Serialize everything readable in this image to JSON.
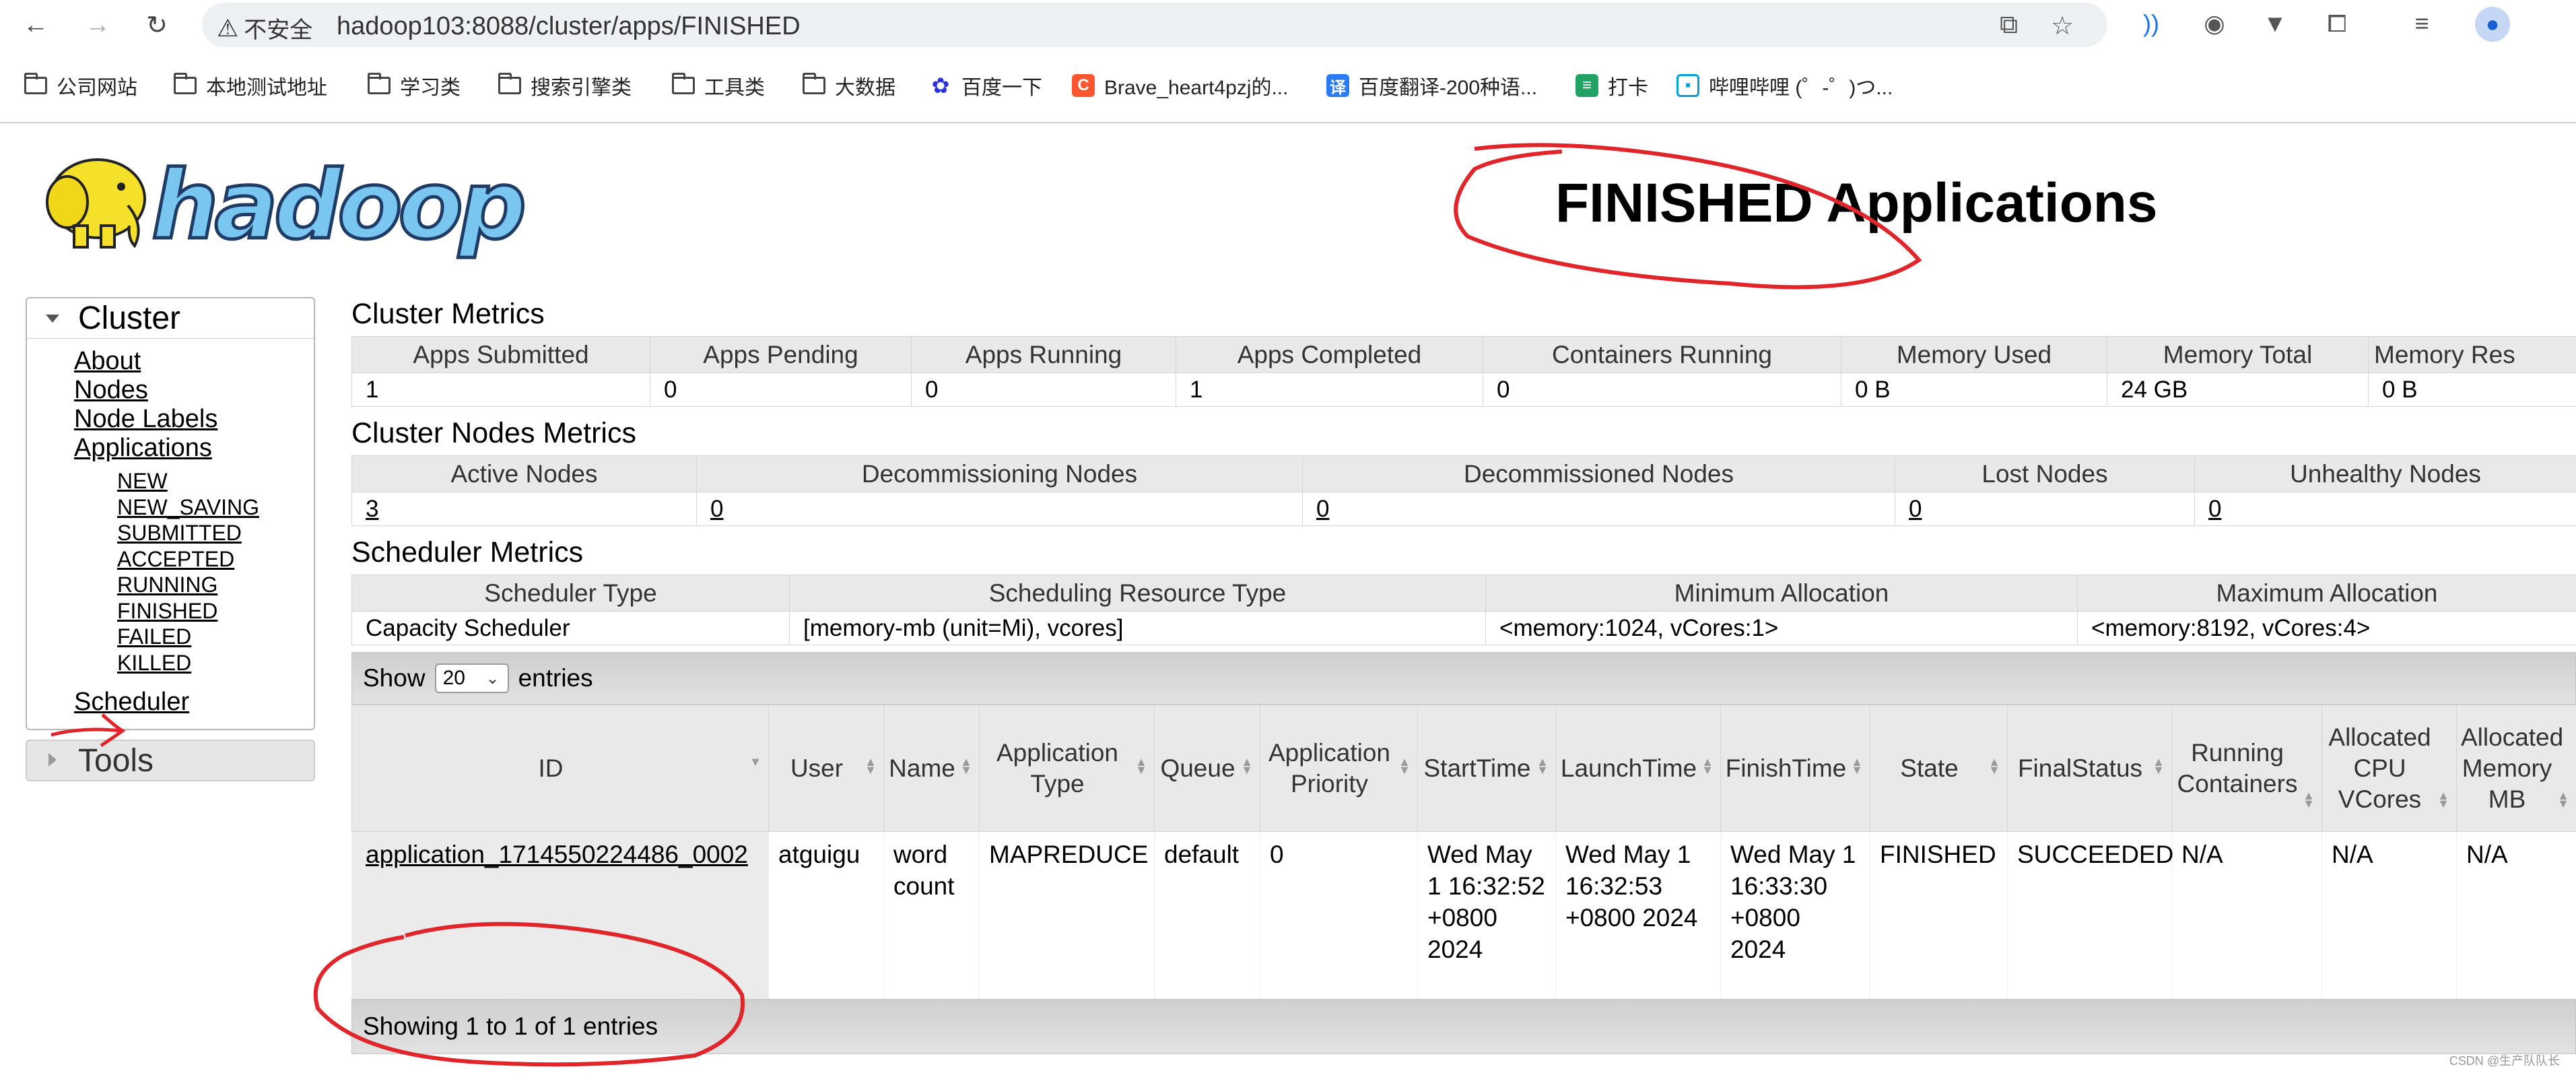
{
  "browser": {
    "security_label": "不安全",
    "url": "hadoop103:8088/cluster/apps/FINISHED",
    "bookmarks": [
      {
        "label": "公司网站",
        "icon": "folder-icon"
      },
      {
        "label": "本地测试地址",
        "icon": "folder-icon"
      },
      {
        "label": "学习类",
        "icon": "folder-icon"
      },
      {
        "label": "搜索引擎类",
        "icon": "folder-icon"
      },
      {
        "label": "工具类",
        "icon": "folder-icon"
      },
      {
        "label": "大数据",
        "icon": "folder-icon"
      },
      {
        "label": "百度一下",
        "icon": "baidu-paw-icon"
      },
      {
        "label": "Brave_heart4pzj的...",
        "icon": "csdn-icon"
      },
      {
        "label": "百度翻译-200种语...",
        "icon": "translate-icon"
      },
      {
        "label": "打卡",
        "icon": "sheet-icon"
      },
      {
        "label": "哔哩哔哩 (゜-゜)つ...",
        "icon": "bilibili-icon"
      }
    ],
    "colors": {
      "baidu": "#2932e1",
      "csdn": "#fc5531",
      "translate": "#2a7bf6",
      "sheet": "#21a366",
      "bilibili": "#00a1d6"
    }
  },
  "header": {
    "logo_text": "hadoop",
    "title": "FINISHED Applications"
  },
  "sidebar": {
    "cluster_label": "Cluster",
    "links": [
      "About",
      "Nodes",
      "Node Labels",
      "Applications"
    ],
    "app_states": [
      "NEW",
      "NEW_SAVING",
      "SUBMITTED",
      "ACCEPTED",
      "RUNNING",
      "FINISHED",
      "FAILED",
      "KILLED"
    ],
    "scheduler_label": "Scheduler",
    "tools_label": "Tools"
  },
  "cluster_metrics": {
    "title": "Cluster Metrics",
    "headers": [
      "Apps Submitted",
      "Apps Pending",
      "Apps Running",
      "Apps Completed",
      "Containers Running",
      "Memory Used",
      "Memory Total",
      "Memory Res"
    ],
    "values": [
      "1",
      "0",
      "0",
      "1",
      "0",
      "0 B",
      "24 GB",
      "0 B"
    ]
  },
  "nodes_metrics": {
    "title": "Cluster Nodes Metrics",
    "headers": [
      "Active Nodes",
      "Decommissioning Nodes",
      "Decommissioned Nodes",
      "Lost Nodes",
      "Unhealthy Nodes"
    ],
    "values": [
      "3",
      "0",
      "0",
      "0",
      "0"
    ]
  },
  "scheduler_metrics": {
    "title": "Scheduler Metrics",
    "headers": [
      "Scheduler Type",
      "Scheduling Resource Type",
      "Minimum Allocation",
      "Maximum Allocation"
    ],
    "values": [
      "Capacity Scheduler",
      "[memory-mb (unit=Mi), vcores]",
      "<memory:1024, vCores:1>",
      "<memory:8192, vCores:4>"
    ]
  },
  "apps_table": {
    "show_label": "Show",
    "entries_value": "20",
    "entries_label": "entries",
    "headers": [
      "ID",
      "User",
      "Name",
      "Application Type",
      "Queue",
      "Application Priority",
      "StartTime",
      "LaunchTime",
      "FinishTime",
      "State",
      "FinalStatus",
      "Running Containers",
      "Allocated CPU VCores",
      "Allocated Memory MB"
    ],
    "row": {
      "id": "application_1714550224486_0002",
      "user": "atguigu",
      "name": "word count",
      "type": "MAPREDUCE",
      "queue": "default",
      "priority": "0",
      "start": "Wed May 1 16:32:52 +0800 2024",
      "launch": "Wed May 1 16:32:53 +0800 2024",
      "finish": "Wed May 1 16:33:30 +0800 2024",
      "state": "FINISHED",
      "final_status": "SUCCEEDED",
      "running_containers": "N/A",
      "alloc_vcores": "N/A",
      "alloc_mem": "N/A"
    },
    "footer": "Showing 1 to 1 of 1 entries"
  },
  "watermark": "CSDN @生产队队长",
  "annotation_color": "#e0262a"
}
